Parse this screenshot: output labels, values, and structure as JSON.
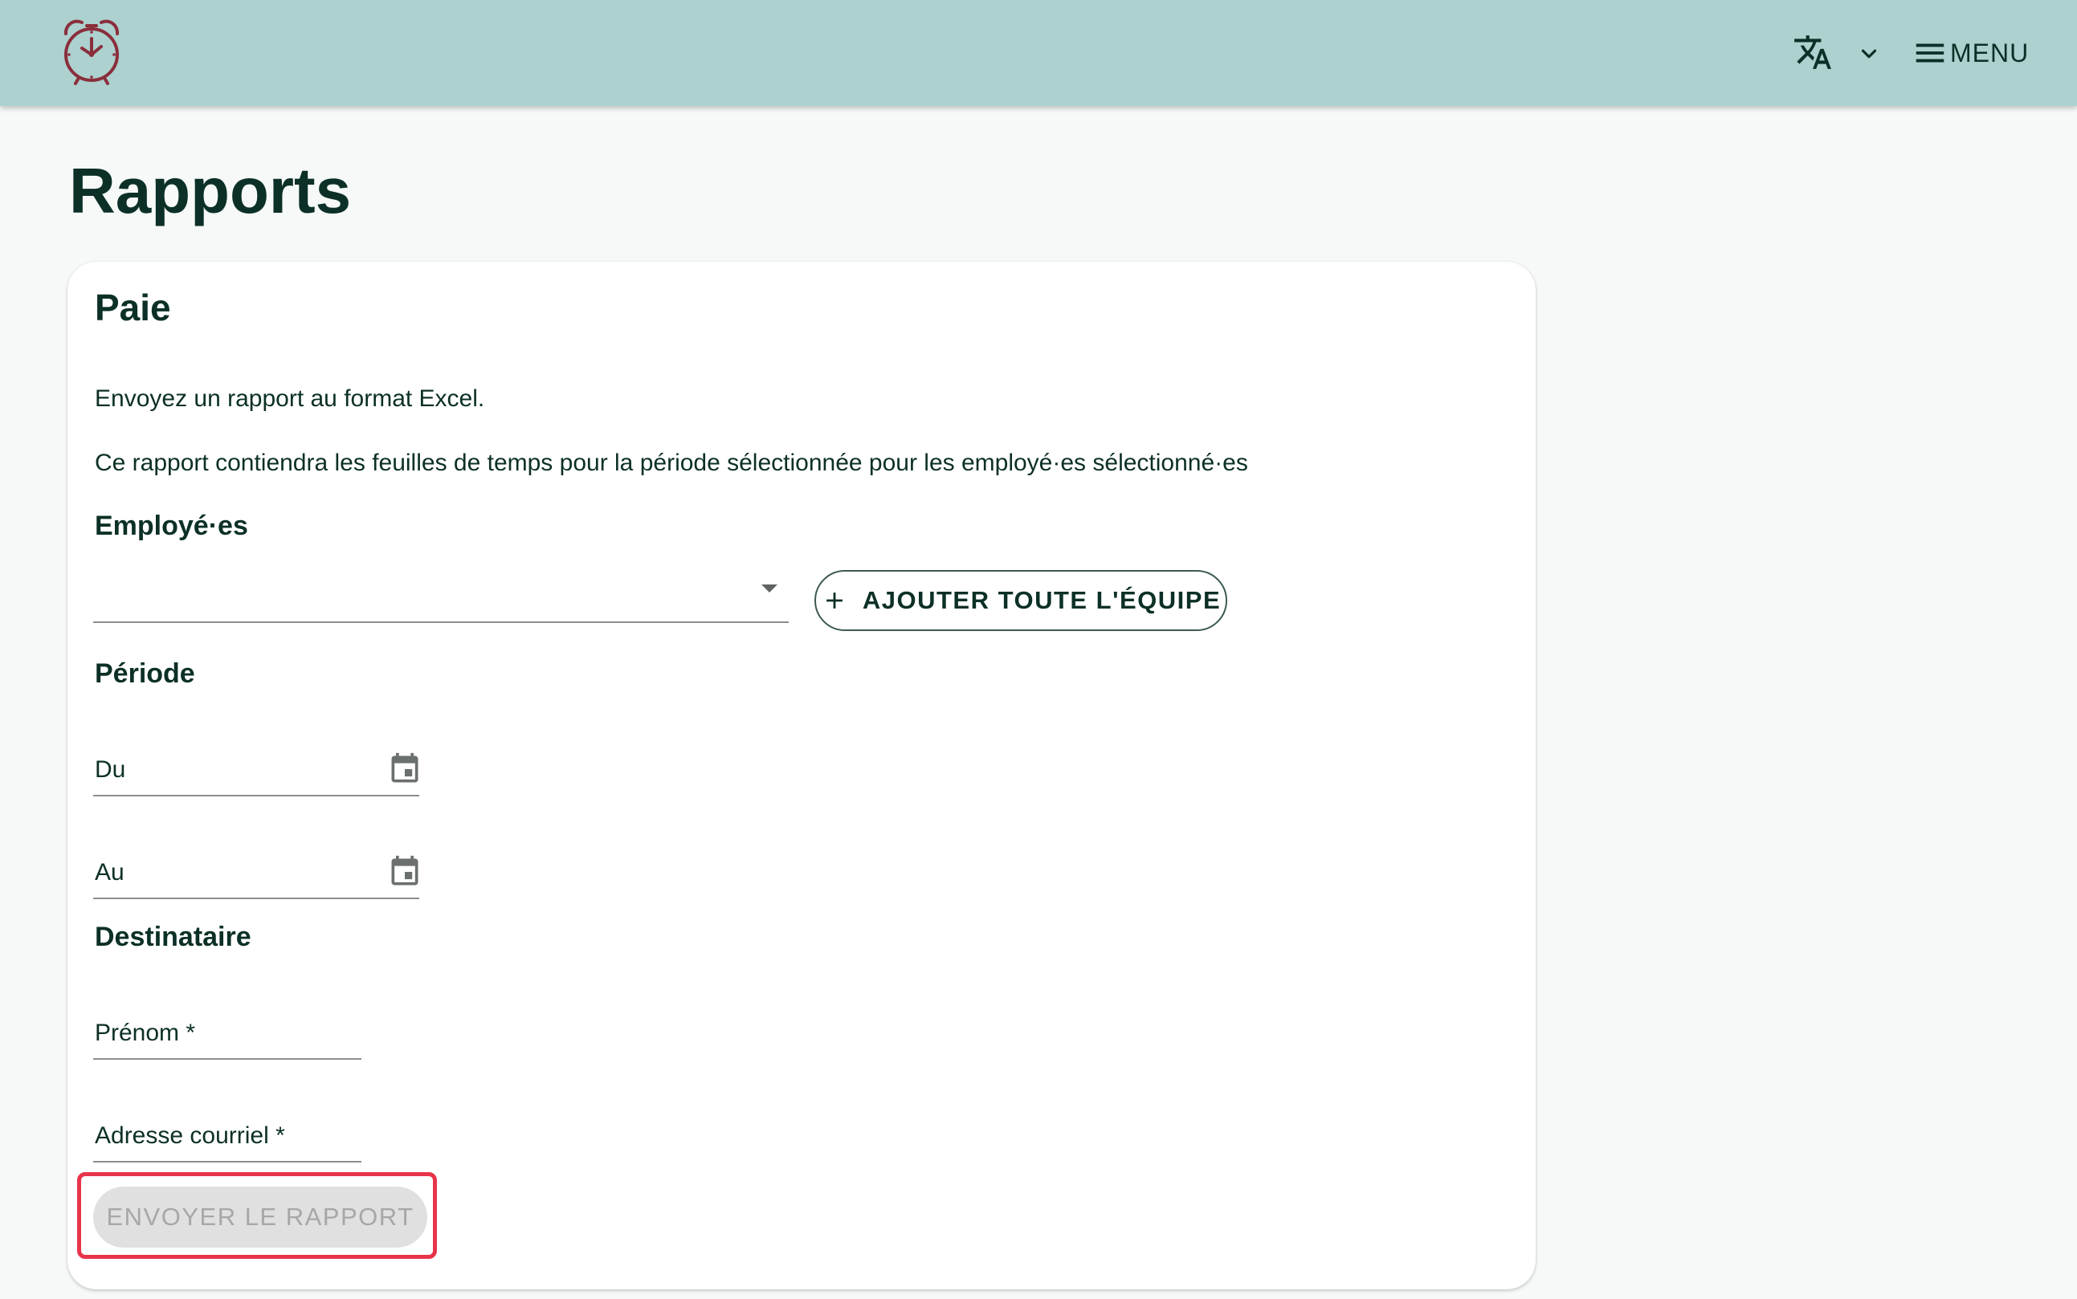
{
  "header": {
    "logo_icon": "alarm-clock-icon",
    "language_icon": "translate-icon",
    "language_chevron_icon": "chevron-down-icon",
    "menu_icon": "hamburger-menu-icon",
    "menu_label": "MENU",
    "background_color": "#acd1ce",
    "logo_color": "#8a2e3c"
  },
  "page": {
    "title": "Rapports"
  },
  "card": {
    "title": "Paie",
    "description_1": "Envoyez un rapport au format Excel.",
    "description_2": "Ce rapport contiendra les feuilles de temps pour la période sélectionnée pour les employé·es sélectionné·es",
    "employees": {
      "label": "Employé·es",
      "selected_value": "",
      "add_team_button": "AJOUTER TOUTE L'ÉQUIPE",
      "add_icon": "plus-icon"
    },
    "period": {
      "label": "Période",
      "from_label": "Du",
      "to_label": "Au",
      "calendar_icon": "calendar-icon"
    },
    "recipient": {
      "label": "Destinataire",
      "first_name_label": "Prénom",
      "email_label": "Adresse courriel",
      "required_marker": " *"
    },
    "submit_button": "ENVOYER LE RAPPORT",
    "submit_disabled": true,
    "highlight_color": "#e8344a"
  }
}
